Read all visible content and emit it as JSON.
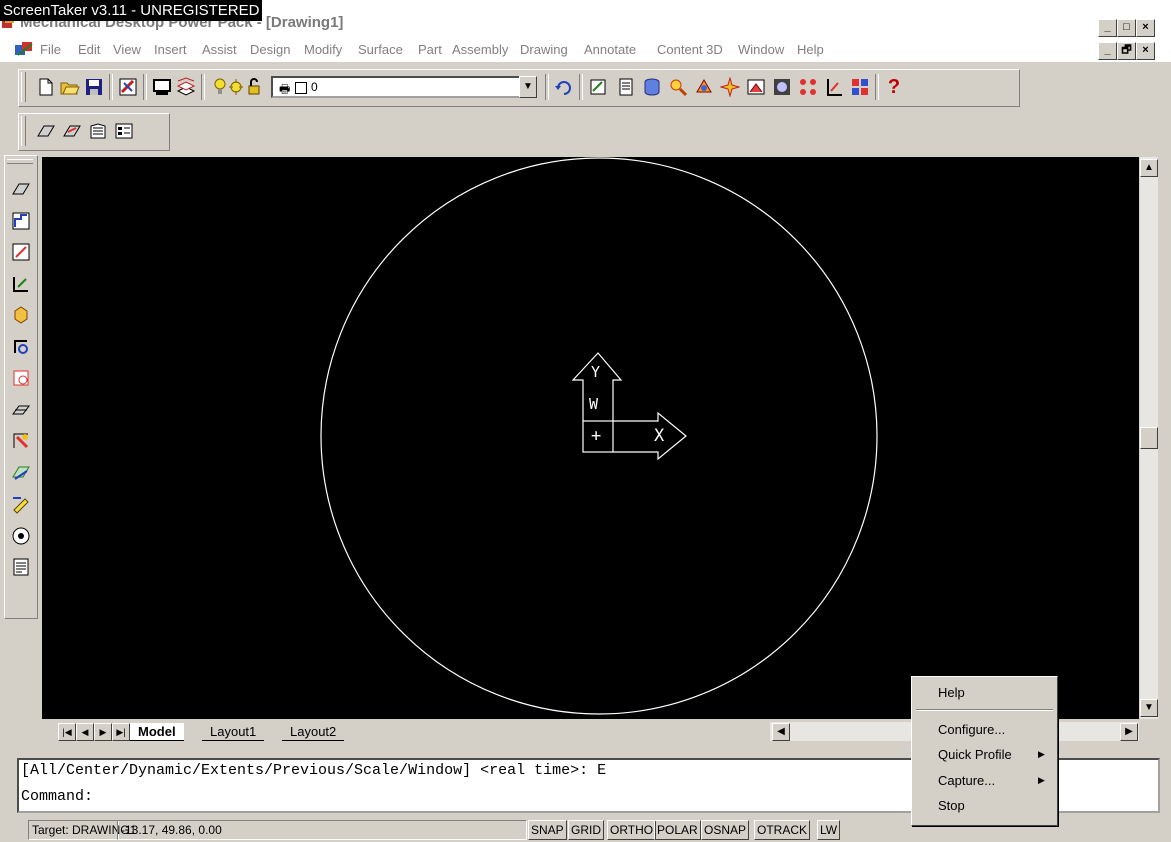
{
  "watermark": "ScreenTaker v3.11 - UNREGISTERED",
  "app": {
    "title": "Mechanical Desktop Power Pack - [Drawing1]"
  },
  "window_controls": {
    "minimize": "_",
    "maximize": "□",
    "close": "×",
    "restore": "🗗"
  },
  "menu": {
    "items": [
      "File",
      "Edit",
      "View",
      "Insert",
      "Assist",
      "Design",
      "Modify",
      "Surface",
      "Part",
      "Assembly",
      "Drawing",
      "Annotate",
      "Content 3D",
      "Window",
      "Help"
    ]
  },
  "layer_toolbar": {
    "current_layer": "0"
  },
  "ucs": {
    "y_label": "Y",
    "w_label": "W",
    "x_label": "X",
    "origin": "+"
  },
  "tabs": {
    "items": [
      "Model",
      "Layout1",
      "Layout2"
    ],
    "active": "Model"
  },
  "command": {
    "history": "[All/Center/Dynamic/Extents/Previous/Scale/Window] <real time>: E",
    "prompt": "Command:"
  },
  "status": {
    "target": "Target: DRAWING1",
    "coords": "-13.17, 49.86, 0.00",
    "toggles": [
      "SNAP",
      "GRID",
      "ORTHO",
      "POLAR",
      "OSNAP",
      "OTRACK",
      "LW"
    ]
  },
  "context_menu": {
    "help": "Help",
    "configure": "Configure...",
    "quick_profile": "Quick Profile",
    "capture": "Capture...",
    "stop": "Stop",
    "submenu_arrow": "▶"
  }
}
